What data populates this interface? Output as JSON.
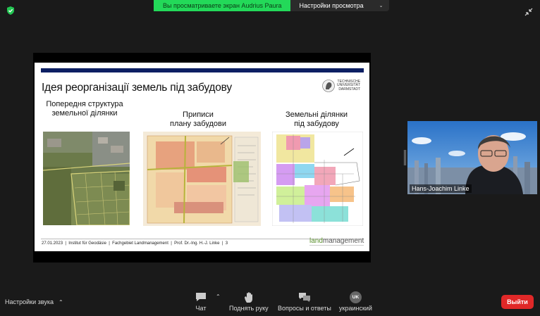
{
  "top_bar": {
    "share_notice": "Вы просматриваете экран Audrius Paura",
    "view_settings_label": "Настройки просмотра"
  },
  "slide": {
    "title": "Ідея реорганізації земель під забудову",
    "logo_lines": [
      "TECHNISCHE",
      "UNIVERSITÄT",
      "DARMSTADT"
    ],
    "columns": [
      {
        "caption_line1": "Попередня структура",
        "caption_line2": "земельної ділянки"
      },
      {
        "caption_line1": "Приписи",
        "caption_line2": "плану забудови"
      },
      {
        "caption_line1": "Земельні ділянки",
        "caption_line2": "під забудову"
      }
    ],
    "footer": "27.01.2023  |  Institut für Geodäsie  |  Fachgebiet Landmanagement  |  Prof. Dr.-Ing. H.-J. Linke  |  3",
    "lm_logo_land": "land",
    "lm_logo_rest": "management"
  },
  "video": {
    "participant_name": "Hans-Joachim Linke"
  },
  "toolbar": {
    "audio_settings": "Настройки звука",
    "chat": "Чат",
    "raise_hand": "Поднять руку",
    "qa": "Вопросы и ответы",
    "language_badge": "UK",
    "language": "украинский",
    "leave": "Выйти"
  },
  "colors": {
    "share_green": "#23d959",
    "leave_red": "#e02828",
    "slide_rule": "#0c1f63"
  }
}
